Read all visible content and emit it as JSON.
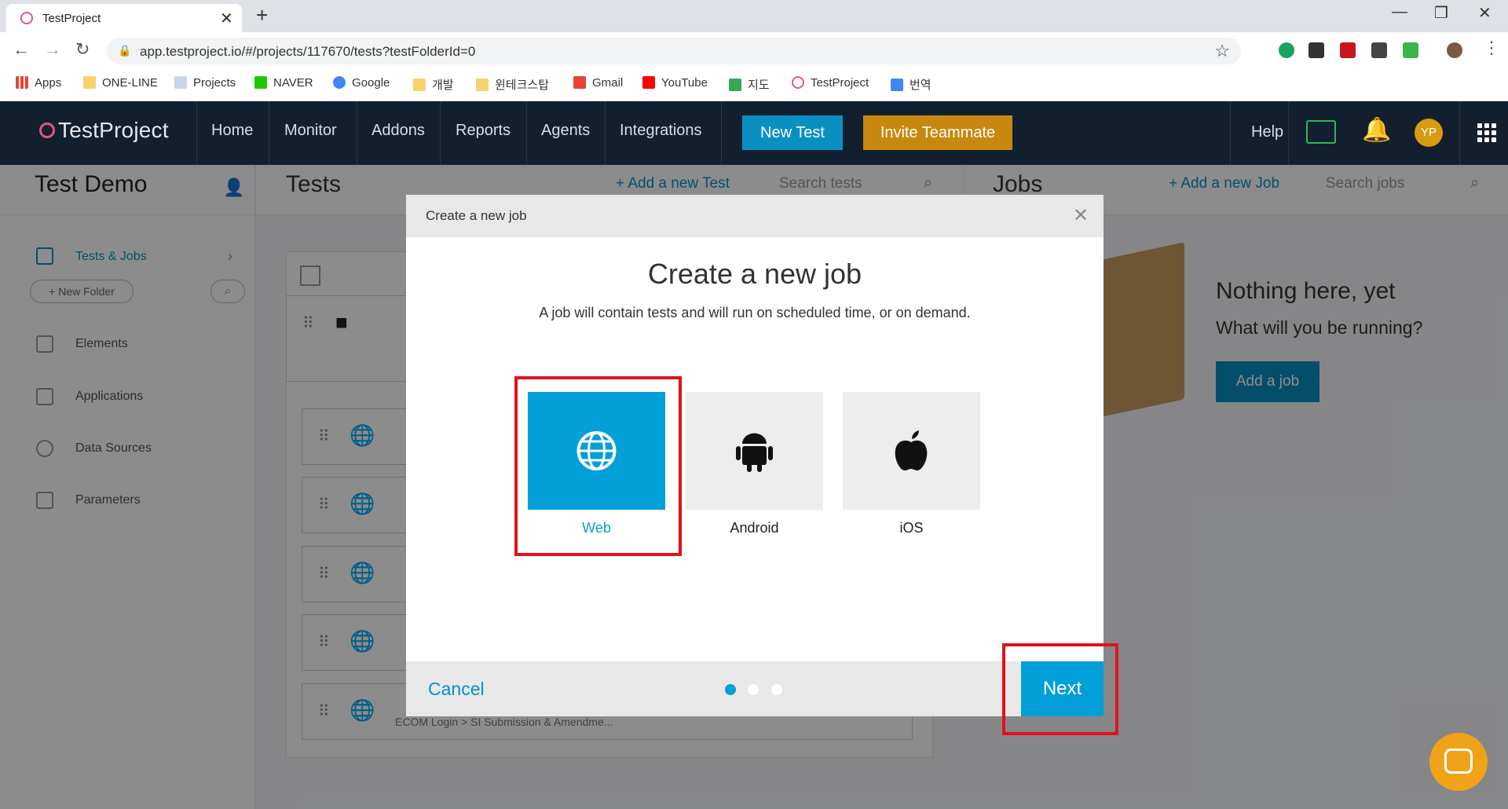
{
  "browser": {
    "tab_title": "TestProject",
    "url": "app.testproject.io/#/projects/117670/tests?testFolderId=0",
    "bookmarks": [
      "Apps",
      "ONE-LINE",
      "Projects",
      "NAVER",
      "Google",
      "개발",
      "윈테크스탑",
      "Gmail",
      "YouTube",
      "지도",
      "TestProject",
      "번역"
    ]
  },
  "header": {
    "logo": "TestProject",
    "nav": [
      "Home",
      "Monitor",
      "Addons",
      "Reports",
      "Agents",
      "Integrations"
    ],
    "new_test": "New Test",
    "invite": "Invite Teammate",
    "help": "Help",
    "avatar": "YP"
  },
  "sidebar": {
    "project_title": "Test Demo",
    "new_folder": "+ New Folder",
    "items": [
      "Tests & Jobs",
      "Elements",
      "Applications",
      "Data Sources",
      "Parameters"
    ]
  },
  "tests": {
    "title": "Tests",
    "add": "+  Add a new Test",
    "search_placeholder": "Search tests",
    "last_row_path": "ECOM Login > SI Submission & Amendme..."
  },
  "jobs": {
    "title": "Jobs",
    "add": "+  Add a new Job",
    "search_placeholder": "Search jobs",
    "empty_title": "Nothing here, yet",
    "empty_sub": "What will you be running?",
    "add_button": "Add a job"
  },
  "modal": {
    "header": "Create a new job",
    "title": "Create a new job",
    "description": "A job will contain tests and will run on scheduled time, or on demand.",
    "platforms": [
      "Web",
      "Android",
      "iOS"
    ],
    "selected": "Web",
    "cancel": "Cancel",
    "next": "Next",
    "step": 1,
    "steps": 3
  },
  "colors": {
    "accent": "#039fd8",
    "highlight": "#e3111b",
    "invite": "#c8880f",
    "appbar": "#121f2f"
  }
}
